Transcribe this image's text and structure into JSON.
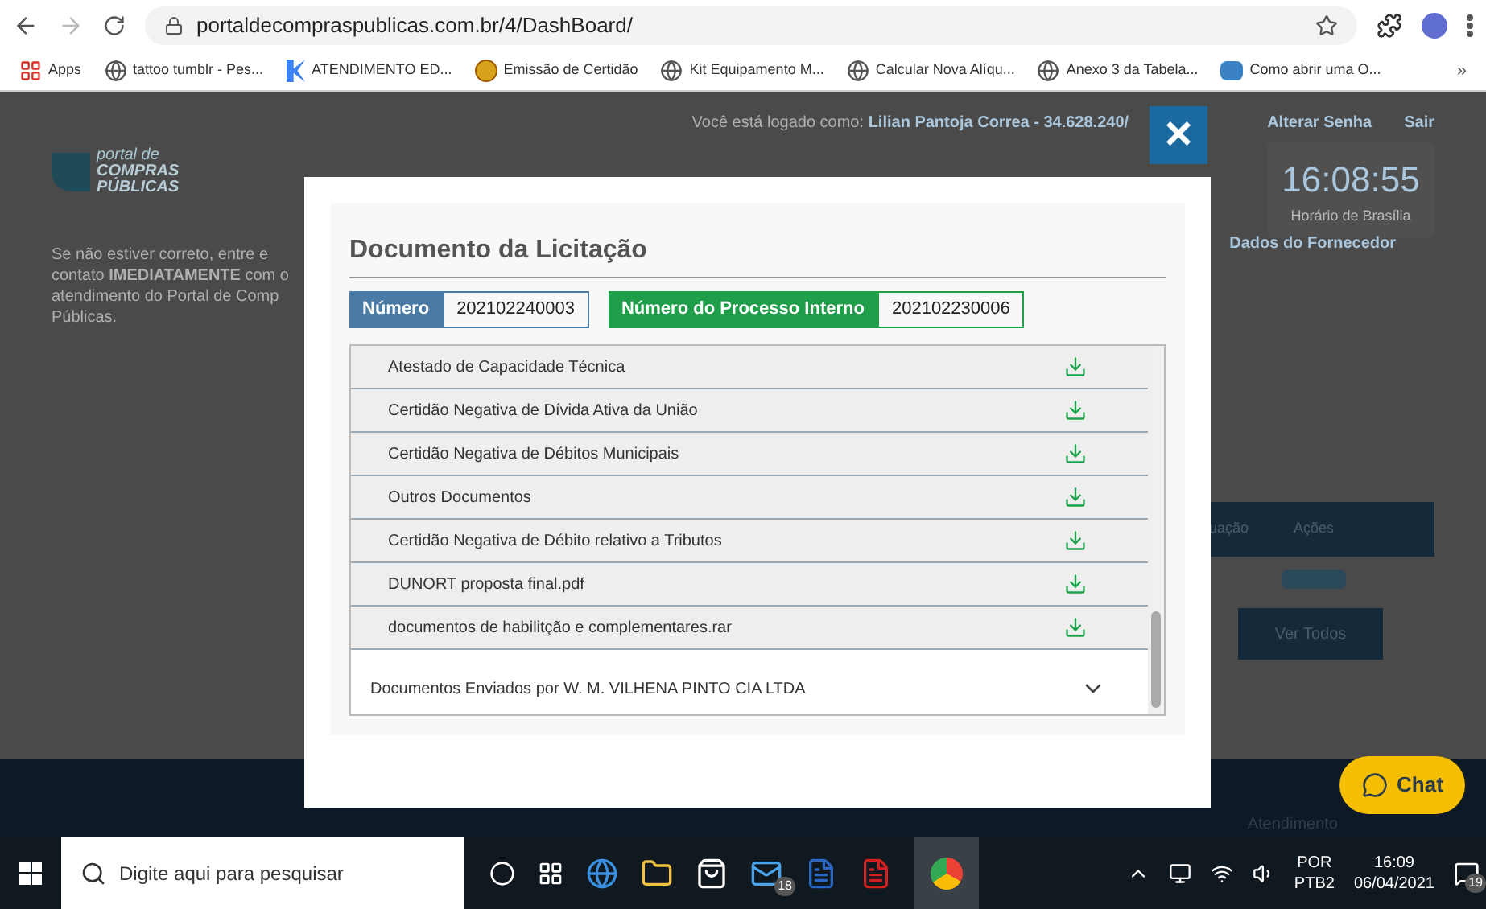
{
  "browser": {
    "url": "portaldecompraspublicas.com.br/4/DashBoard/",
    "bookmarks": [
      {
        "kind": "apps",
        "label": "Apps"
      },
      {
        "kind": "globe",
        "label": "tattoo tumblr - Pes..."
      },
      {
        "kind": "k",
        "label": "ATENDIMENTO ED..."
      },
      {
        "kind": "emblem",
        "label": "Emissão de Certidão"
      },
      {
        "kind": "globe",
        "label": "Kit Equipamento M..."
      },
      {
        "kind": "globe",
        "label": "Calcular Nova Alíqu..."
      },
      {
        "kind": "globe",
        "label": "Anexo 3 da Tabela..."
      },
      {
        "kind": "app",
        "label": "Como abrir uma O..."
      }
    ],
    "more": "»"
  },
  "header": {
    "logged_as": "Você está logado como:",
    "user": "Lilian Pantoja Correa - 34.628.240/",
    "links": [
      "Alterar Senha",
      "Sair"
    ],
    "logo": [
      "portal de",
      "COMPRAS",
      "PÚBLICAS"
    ],
    "clock": "16:08:55",
    "clock_caption": "Horário de Brasília"
  },
  "notice": "Se não estiver correto, entre e contato **IMEDIATAMENTE** com o atendimento do Portal de Comp Públicas.",
  "supplier_link": "Dados do Fornecedor",
  "table_headers": [
    "uação",
    "Ações"
  ],
  "see_all": "Ver Todos",
  "support_label": "Atendimento",
  "chat": "Chat",
  "modal": {
    "close": "×",
    "title": "Documento da Licitação",
    "fields": [
      {
        "label": "Número",
        "value": "202102240003",
        "color": "#4a7ba7"
      },
      {
        "label": "Número do Processo Interno",
        "value": "202102230006",
        "color": "#1f9e4a"
      }
    ],
    "documents": [
      "Atestado de Capacidade Técnica",
      "Certidão Negativa de Dívida Ativa da União",
      "Certidão Negativa de Débitos Municipais",
      "Outros Documentos",
      "Certidão Negativa de Débito relativo a Tributos",
      "DUNORT proposta final.pdf",
      "documentos de habilitção e complementares.rar"
    ],
    "section": {
      "label": "Documentos Enviados por W. M. VILHENA PINTO CIA LTDA",
      "expanded": false
    }
  },
  "taskbar": {
    "search_placeholder": "Digite aqui para pesquisar",
    "mail_badge": "18",
    "language": [
      "POR",
      "PTB2"
    ],
    "time": "16:09",
    "date": "06/04/2021",
    "notifications": "19"
  }
}
